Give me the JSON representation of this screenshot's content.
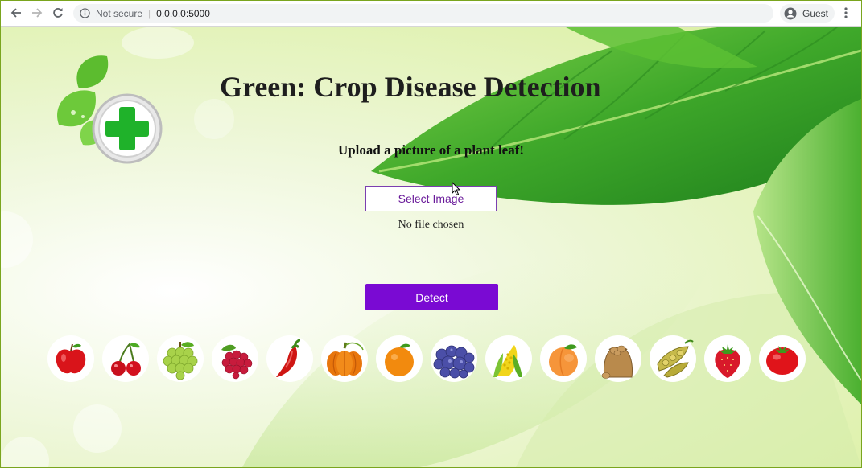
{
  "browser": {
    "security_label": "Not secure",
    "separator": "|",
    "url": "0.0.0.0:5000",
    "profile_label": "Guest"
  },
  "page": {
    "title": "Green: Crop Disease Detection",
    "subtitle": "Upload a picture of a plant leaf!",
    "select_button_label": "Select Image",
    "file_status": "No file chosen",
    "detect_button_label": "Detect"
  },
  "colors": {
    "accent_purple": "#7a0ad3",
    "leaf_green": "#4caf2a",
    "title_text": "#1e1e1e"
  },
  "fruits": [
    "apple-icon",
    "cherry-icon",
    "grapes-icon",
    "raspberry-icon",
    "pepper-icon",
    "pumpkin-icon",
    "orange-icon",
    "blueberry-icon",
    "corn-icon",
    "peach-icon",
    "potato-icon",
    "soybean-icon",
    "strawberry-icon",
    "tomato-icon"
  ]
}
